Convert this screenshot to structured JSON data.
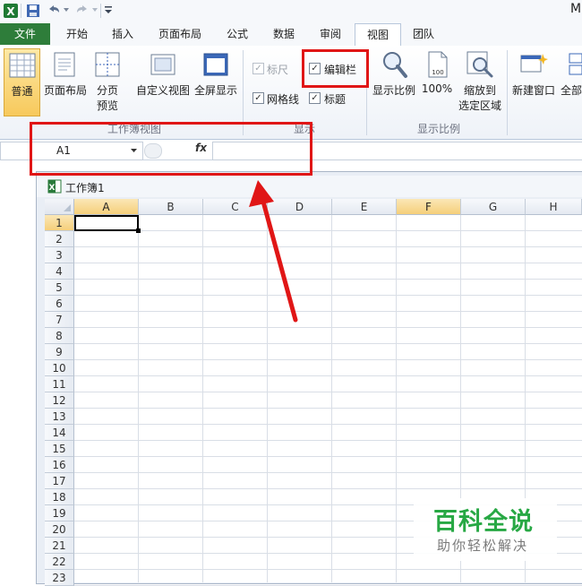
{
  "app": {
    "title_fragment": "M"
  },
  "tabs": [
    {
      "label": "文件"
    },
    {
      "label": "开始"
    },
    {
      "label": "插入"
    },
    {
      "label": "页面布局"
    },
    {
      "label": "公式"
    },
    {
      "label": "数据"
    },
    {
      "label": "审阅"
    },
    {
      "label": "视图"
    },
    {
      "label": "团队"
    }
  ],
  "active_tab": "视图",
  "ribbon": {
    "workbook_views": {
      "group_label": "工作簿视图",
      "normal": "普通",
      "page_layout": "页面布局",
      "page_break_preview": [
        "分页",
        "预览"
      ],
      "custom_views": "自定义视图",
      "full_screen": "全屏显示"
    },
    "show": {
      "group_label": "显示",
      "ruler": "标尺",
      "formula_bar": "编辑栏",
      "gridlines": "网格线",
      "headings": "标题",
      "ruler_checked": true,
      "formula_bar_checked": true,
      "gridlines_checked": true,
      "headings_checked": true
    },
    "zoom": {
      "group_label": "显示比例",
      "zoom": "显示比例",
      "hundred": "100%",
      "zoom_to_selection": [
        "缩放到",
        "选定区域"
      ],
      "icon_text": "100"
    },
    "window": {
      "new_window": "新建窗口",
      "arrange_all": "全部"
    }
  },
  "formula_bar": {
    "name_box": "A1",
    "fx": "fx",
    "value": ""
  },
  "workbook": {
    "title": "工作簿1"
  },
  "sheet": {
    "columns": [
      "A",
      "B",
      "C",
      "D",
      "E",
      "F",
      "G",
      "H"
    ],
    "rows": [
      "1",
      "2",
      "3",
      "4",
      "5",
      "6",
      "7",
      "8",
      "9",
      "10",
      "11",
      "12",
      "13",
      "14",
      "15",
      "16",
      "17",
      "18",
      "19",
      "20",
      "21",
      "22",
      "23"
    ],
    "selected_cell": "A1",
    "highlighted_column": "F"
  },
  "watermark": {
    "title": "百科全说",
    "subtitle": "助你轻松解决"
  },
  "colors": {
    "file_tab": "#2e7d3a",
    "annotation": "#e01616",
    "watermark": "#27a844"
  }
}
